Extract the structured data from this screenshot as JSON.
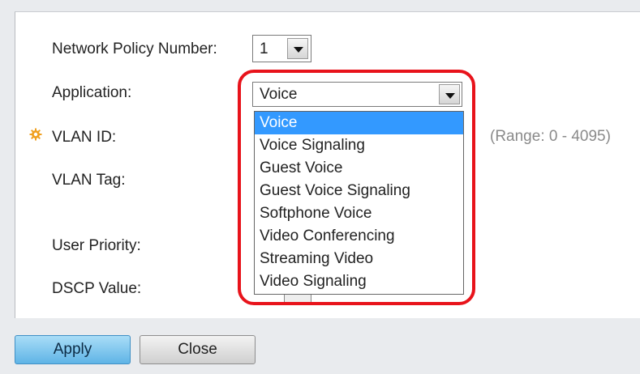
{
  "form": {
    "network_policy_label": "Network Policy Number:",
    "network_policy_value": "1",
    "application_label": "Application:",
    "application_value": "Voice",
    "vlan_id_label": "VLAN ID:",
    "vlan_id_range": "(Range: 0 - 4095)",
    "vlan_tag_label": "VLAN Tag:",
    "user_priority_label": "User Priority:",
    "dscp_value_label": "DSCP Value:"
  },
  "application_dropdown": {
    "options": [
      "Voice",
      "Voice Signaling",
      "Guest Voice",
      "Guest Voice Signaling",
      "Softphone Voice",
      "Video Conferencing",
      "Streaming Video",
      "Video Signaling"
    ],
    "selected_index": 0
  },
  "buttons": {
    "apply": "Apply",
    "close": "Close"
  },
  "colors": {
    "highlight": "#e8131b",
    "selected_option": "#3399ff",
    "required_icon": "#f0a020"
  },
  "icons": {
    "required": "required-field-icon",
    "dropdown": "chevron-down-icon"
  }
}
